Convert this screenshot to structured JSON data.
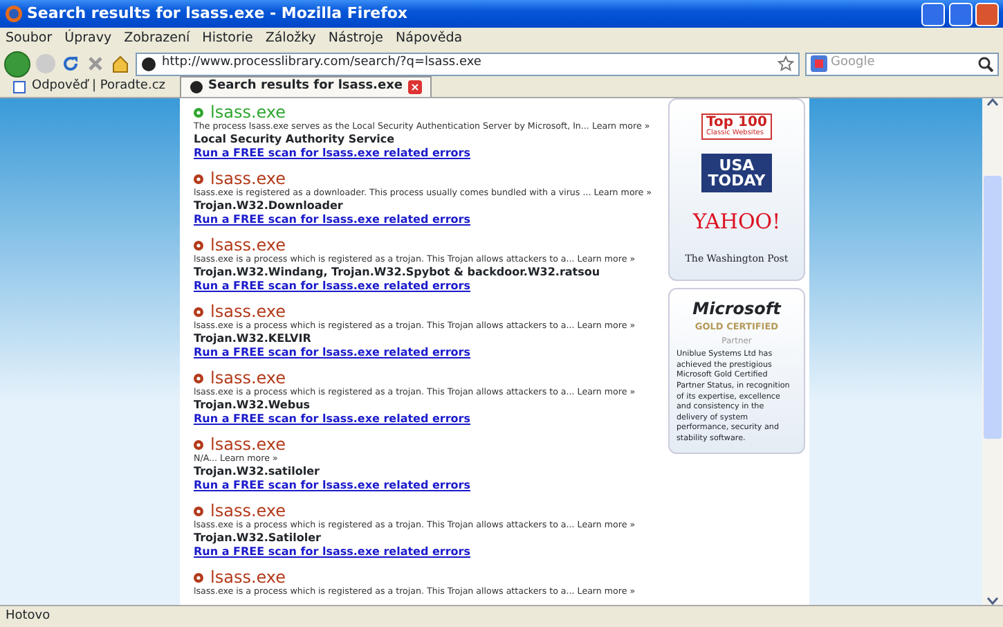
{
  "window": {
    "title": "Search results for lsass.exe - Mozilla Firefox"
  },
  "menu": [
    "Soubor",
    "Úpravy",
    "Zobrazení",
    "Historie",
    "Záložky",
    "Nástroje",
    "Nápověda"
  ],
  "address_bar": {
    "value": "http://www.processlibrary.com/search/?q=lsass.exe"
  },
  "search": {
    "placeholder": "Google"
  },
  "tabs": [
    {
      "label": "Odpověď | Poradte.cz",
      "selected": false
    },
    {
      "label": "Search results for lsass.exe",
      "selected": true
    }
  ],
  "results": [
    {
      "kind": "safe",
      "name": "lsass.exe",
      "description": "The process lsass.exe serves as the Local Security Authentication Server by Microsoft, In...",
      "learn_more": "Learn more »",
      "detail": "Local Security Authority Service",
      "scan_link": "Run a FREE scan for lsass.exe related errors"
    },
    {
      "kind": "threat",
      "name": "lsass.exe",
      "description": "lsass.exe is registered as a downloader. This process usually comes bundled with a virus ...",
      "learn_more": "Learn more »",
      "detail": "Trojan.W32.Downloader",
      "scan_link": "Run a FREE scan for lsass.exe related errors"
    },
    {
      "kind": "threat",
      "name": "lsass.exe",
      "description": "lsass.exe is a process which is registered as a trojan. This Trojan allows attackers to a...",
      "learn_more": "Learn more »",
      "detail": "Trojan.W32.Windang, Trojan.W32.Spybot & backdoor.W32.ratsou",
      "scan_link": "Run a FREE scan for lsass.exe related errors"
    },
    {
      "kind": "threat",
      "name": "lsass.exe",
      "description": "lsass.exe is a process which is registered as a trojan. This Trojan allows attackers to a...",
      "learn_more": "Learn more »",
      "detail": "Trojan.W32.KELVIR",
      "scan_link": "Run a FREE scan for lsass.exe related errors"
    },
    {
      "kind": "threat",
      "name": "lsass.exe",
      "description": "lsass.exe is a process which is registered as a trojan. This Trojan allows attackers to a...",
      "learn_more": "Learn more »",
      "detail": "Trojan.W32.Webus",
      "scan_link": "Run a FREE scan for lsass.exe related errors"
    },
    {
      "kind": "threat",
      "name": "lsass.exe",
      "description": "N/A...",
      "learn_more": "Learn more »",
      "detail": "Trojan.W32.satiloler",
      "scan_link": "Run a FREE scan for lsass.exe related errors"
    },
    {
      "kind": "threat",
      "name": "lsass.exe",
      "description": "lsass.exe is a process which is registered as a trojan. This Trojan allows attackers to a...",
      "learn_more": "Learn more »",
      "detail": "Trojan.W32.Satiloler",
      "scan_link": "Run a FREE scan for lsass.exe related errors"
    },
    {
      "kind": "threat",
      "name": "lsass.exe",
      "description": "lsass.exe is a process which is registered as a trojan. This Trojan allows attackers to a...",
      "learn_more": "Learn more »"
    }
  ],
  "sidebar": {
    "logos": [
      {
        "kind": "pc",
        "text": "Top 100",
        "subtext": "Classic Websites"
      },
      {
        "kind": "usa",
        "text": "USA",
        "subtext": "TODAY"
      },
      {
        "kind": "yahoo",
        "text": "YAHOO!"
      },
      {
        "kind": "wapo",
        "text": "The Washington Post"
      }
    ],
    "partner": {
      "brand": "Microsoft",
      "level": "GOLD CERTIFIED",
      "role": "Partner",
      "text": "Uniblue Systems Ltd has achieved the prestigious Microsoft Gold Certified Partner Status, in recognition of its expertise, excellence and consistency in the delivery of system performance, security and stability software."
    }
  },
  "status_bar": {
    "text": "Hotovo"
  }
}
